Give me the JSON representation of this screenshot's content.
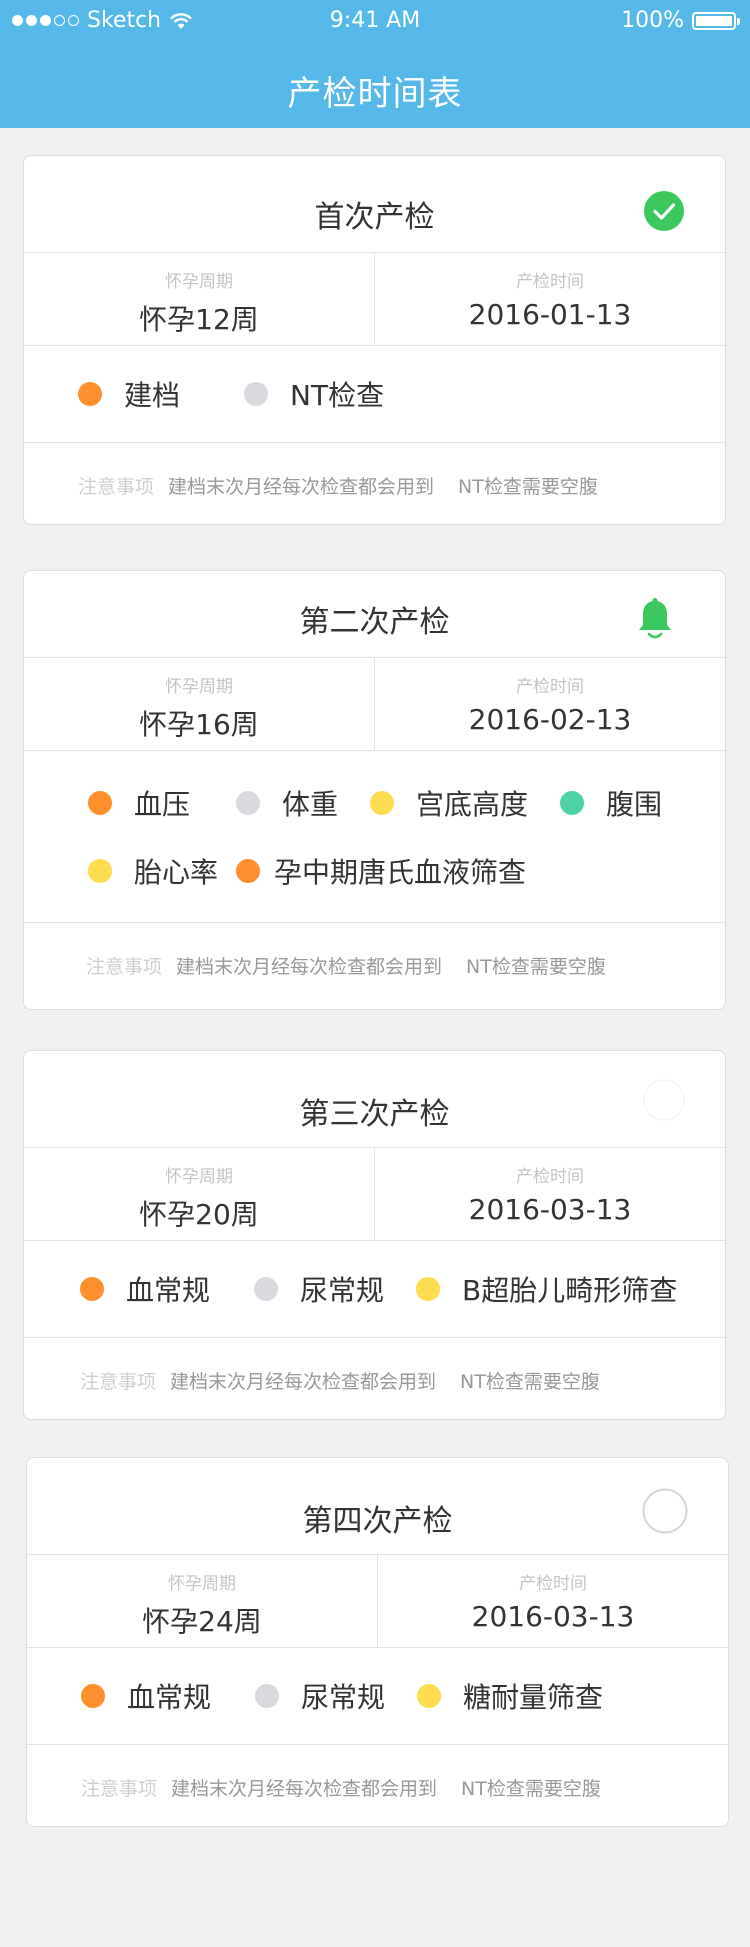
{
  "status_bar": {
    "carrier": "Sketch",
    "time": "9:41 AM",
    "battery": "100%"
  },
  "header": {
    "title": "产检时间表"
  },
  "colors": {
    "header_bg": "#55b8e8",
    "orange": "#fd8f2c",
    "gray": "#dcd8e0",
    "yellow": "#fddc4f",
    "teal": "#4fd1a7",
    "done_green": "#3cc85c",
    "bell_green": "#3cc85c"
  },
  "labels": {
    "week_label": "怀孕周期",
    "date_label": "产检时间",
    "note_label": "注意事项"
  },
  "cards": [
    {
      "title": "首次产检",
      "status": "done",
      "status_icon": "check-circle-icon",
      "week": "怀孕12周",
      "date": "2016-01-13",
      "items": [
        {
          "label": "建档",
          "color": "orange"
        },
        {
          "label": "NT检查",
          "color": "gray"
        }
      ],
      "notes": [
        "建档末次月经每次检查都会用到",
        "NT检查需要空腹"
      ]
    },
    {
      "title": "第二次产检",
      "status": "reminder",
      "status_icon": "bell-icon",
      "week": "怀孕16周",
      "date": "2016-02-13",
      "items": [
        {
          "label": "血压",
          "color": "orange"
        },
        {
          "label": "体重",
          "color": "gray"
        },
        {
          "label": "宫底高度",
          "color": "yellow"
        },
        {
          "label": "腹围",
          "color": "teal"
        },
        {
          "label": "胎心率",
          "color": "yellow"
        },
        {
          "label": "孕中期唐氏血液筛查",
          "color": "orange"
        }
      ],
      "notes": [
        "建档末次月经每次检查都会用到",
        "NT检查需要空腹"
      ]
    },
    {
      "title": "第三次产检",
      "status": "pending",
      "status_icon": "empty-circle-icon",
      "week": "怀孕20周",
      "date": "2016-03-13",
      "items": [
        {
          "label": "血常规",
          "color": "orange"
        },
        {
          "label": "尿常规",
          "color": "gray"
        },
        {
          "label": "B超胎儿畸形筛查",
          "color": "yellow"
        }
      ],
      "notes": [
        "建档末次月经每次检查都会用到",
        "NT检查需要空腹"
      ]
    },
    {
      "title": "第四次产检",
      "status": "pending",
      "status_icon": "empty-circle-icon",
      "week": "怀孕24周",
      "date": "2016-03-13",
      "items": [
        {
          "label": "血常规",
          "color": "orange"
        },
        {
          "label": "尿常规",
          "color": "gray"
        },
        {
          "label": "糖耐量筛查",
          "color": "yellow"
        }
      ],
      "notes": [
        "建档末次月经每次检查都会用到",
        "NT检查需要空腹"
      ]
    }
  ]
}
